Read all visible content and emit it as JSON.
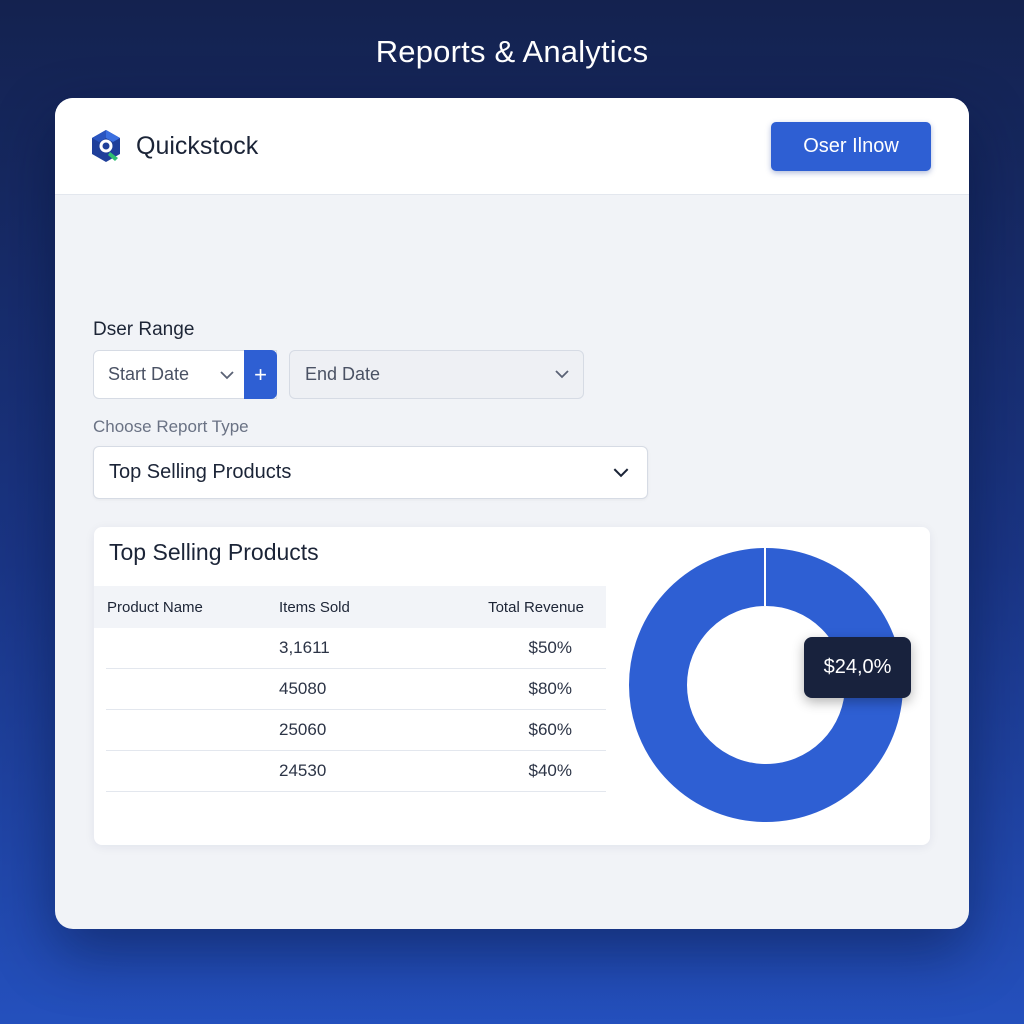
{
  "page": {
    "heading": "Reports & Analytics"
  },
  "header": {
    "brand": "Quickstock",
    "primary_button": "Oser Ilnow",
    "accent_color": "#2e5fd3"
  },
  "filters": {
    "date_range_label": "Dser Range",
    "start_date_placeholder": "Start Date",
    "add_button": "+",
    "end_date_placeholder": "End Date",
    "report_type_label": "Choose Report Type",
    "report_type_selected": "Top Selling Products"
  },
  "report": {
    "title": "Top Selling Products",
    "columns": [
      "Product Name",
      "Items Sold",
      "Total Revenue"
    ],
    "rows": [
      {
        "name": "",
        "items_sold": "3,1611",
        "revenue": "$50%"
      },
      {
        "name": "",
        "items_sold": "45080",
        "revenue": "$80%"
      },
      {
        "name": "",
        "items_sold": "25060",
        "revenue": "$60%"
      },
      {
        "name": "",
        "items_sold": "24530",
        "revenue": "$40%"
      }
    ],
    "donut": {
      "color": "#2e5fd3",
      "tooltip": "$24,0%"
    }
  },
  "icons": {
    "brand_logo": "quickstock-logo-icon",
    "dropdown": "chevron-down-icon",
    "add": "plus-icon"
  }
}
